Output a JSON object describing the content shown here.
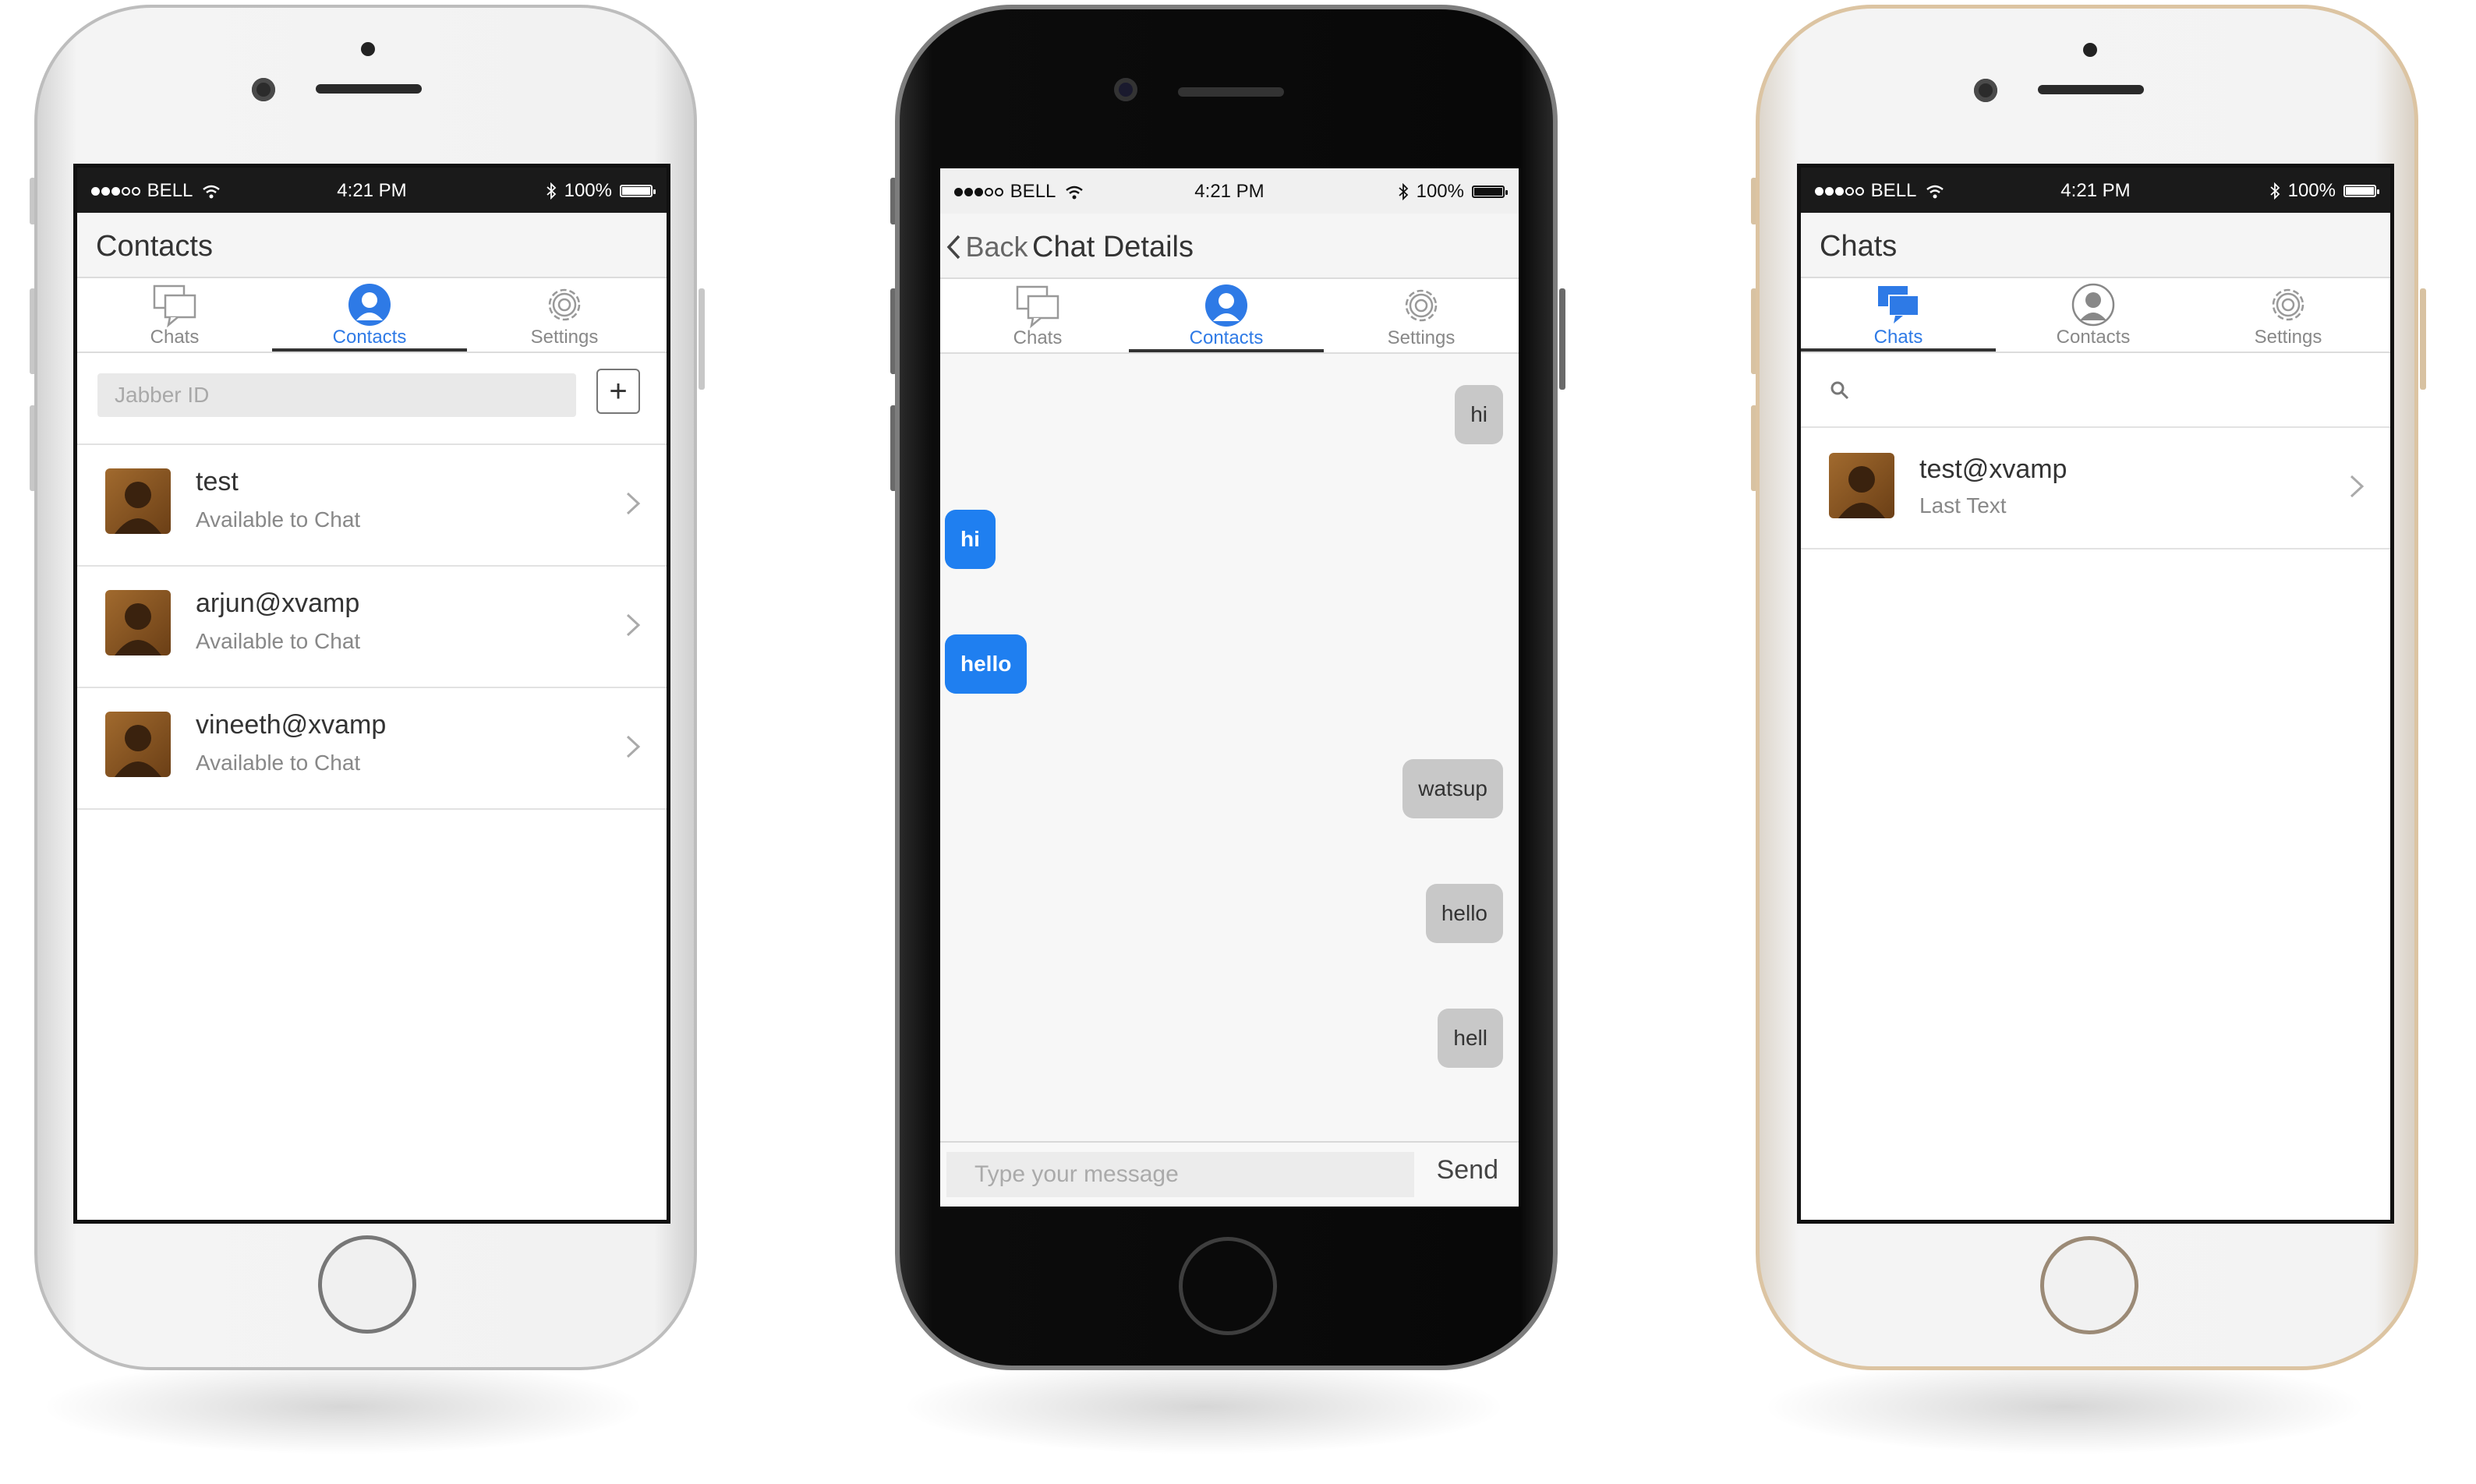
{
  "status_bar": {
    "carrier": "BELL",
    "time": "4:21 PM",
    "battery": "100%",
    "battery_level": 1.0
  },
  "phone1": {
    "nav_title": "Contacts",
    "tabs": [
      {
        "label": "Chats",
        "icon": "chat-bubbles-icon",
        "active": false
      },
      {
        "label": "Contacts",
        "icon": "person-icon",
        "active": true
      },
      {
        "label": "Settings",
        "icon": "gear-icon",
        "active": false
      }
    ],
    "jabber_placeholder": "Jabber ID",
    "add_label": "+",
    "contacts": [
      {
        "name": "test",
        "status": "Available to Chat"
      },
      {
        "name": "arjun@xvamp",
        "status": "Available to Chat"
      },
      {
        "name": "vineeth@xvamp",
        "status": "Available to Chat"
      }
    ]
  },
  "phone2": {
    "back_label": "Back",
    "nav_title": "Chat Details",
    "tabs": [
      {
        "label": "Chats",
        "icon": "chat-bubbles-icon",
        "active": false
      },
      {
        "label": "Contacts",
        "icon": "person-icon",
        "active": true
      },
      {
        "label": "Settings",
        "icon": "gear-icon",
        "active": false
      }
    ],
    "messages": [
      {
        "text": "hi",
        "direction": "incoming"
      },
      {
        "text": "hi",
        "direction": "outgoing"
      },
      {
        "text": "hello",
        "direction": "outgoing"
      },
      {
        "text": "watsup",
        "direction": "incoming"
      },
      {
        "text": "hello",
        "direction": "incoming"
      },
      {
        "text": "hell",
        "direction": "incoming"
      }
    ],
    "message_placeholder": "Type your message",
    "send_label": "Send"
  },
  "phone3": {
    "nav_title": "Chats",
    "tabs": [
      {
        "label": "Chats",
        "icon": "chat-bubbles-icon",
        "active": true
      },
      {
        "label": "Contacts",
        "icon": "person-icon",
        "active": false
      },
      {
        "label": "Settings",
        "icon": "gear-icon",
        "active": false
      }
    ],
    "chats": [
      {
        "name": "test@xvamp",
        "last": "Last Text"
      }
    ]
  },
  "colors": {
    "accent": "#2e7ae6",
    "outgoing_bubble": "#1f7ff0",
    "incoming_bubble": "#c8c8c8"
  }
}
